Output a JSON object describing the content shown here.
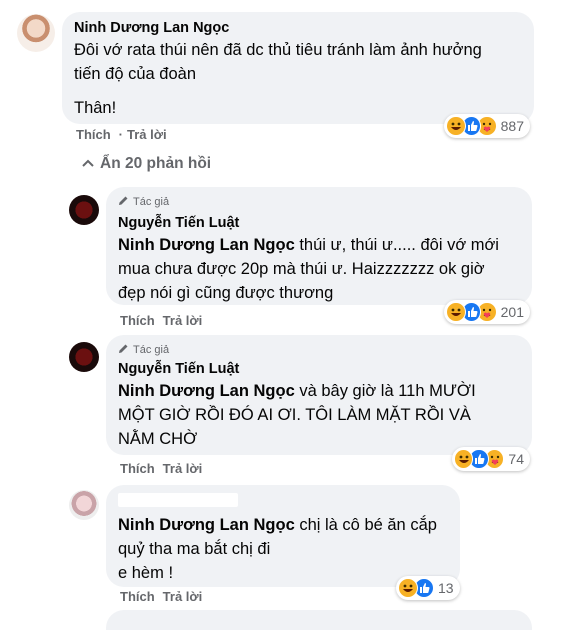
{
  "colors": {
    "bubble": "#f0f2f5",
    "meta": "#65676b",
    "text": "#050505",
    "like": "#1877f2",
    "haha": "#f7b125"
  },
  "comment1": {
    "author": "Ninh Dương Lan Ngọc",
    "line1": "Đôi vớ rata thúi nên đã dc thủ tiêu tránh làm ảnh hưởng",
    "line2": "tiến độ của đoàn",
    "line3": "Thân!",
    "like": "Thích",
    "reply": "Trả lời",
    "reaction_count": "887"
  },
  "toggle_replies": "Ẩn 20 phản hồi",
  "reply1": {
    "badge": "Tác giả",
    "author": "Nguyễn Tiến Luật",
    "mention": "Ninh Dương Lan Ngọc",
    "line1_rest": " thúi ư, thúi ư..... đôi vớ mới",
    "line2": "mua chưa được 20p mà thúi ư. Haizzzzzzz ok giờ",
    "line3": "đẹp nói gì cũng được thương",
    "like": "Thích",
    "reply": "Trả lời",
    "reaction_count": "201"
  },
  "reply2": {
    "badge": "Tác giả",
    "author": "Nguyễn Tiến Luật",
    "mention": "Ninh Dương Lan Ngọc",
    "line1_rest": " và bây giờ là 11h MƯỜI",
    "line2": "MỘT GIỜ RỒI ĐÓ AI ƠI. TÔI LÀM MẶT RỒI VÀ",
    "line3": "NẰM CHỜ",
    "like": "Thích",
    "reply": "Trả lời",
    "reaction_count": "74"
  },
  "reply3": {
    "mention": "Ninh Dương Lan Ngọc",
    "line1_rest": " chị là cô bé ăn cắp",
    "line2": "quỷ tha ma bắt chị đi",
    "line3": "e hèm !",
    "like": "Thích",
    "reply": "Trả lời",
    "reaction_count": "13"
  }
}
